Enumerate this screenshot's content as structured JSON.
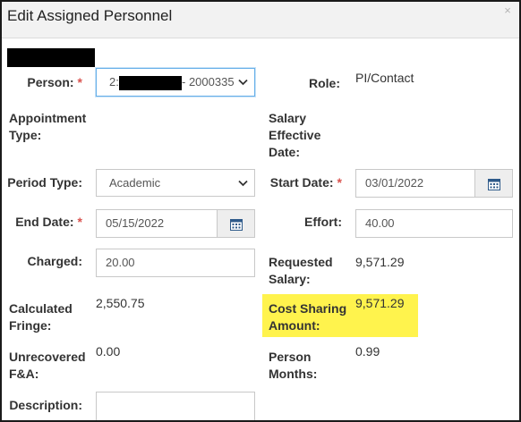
{
  "dialog": {
    "title": "Edit Assigned Personnel",
    "close_glyph": "×"
  },
  "form": {
    "person_label": "Person:",
    "person_value_prefix": "2:",
    "person_value_suffix": "- 2000335",
    "role_label": "Role:",
    "role_value": "PI/Contact",
    "appointment_type_label_line1": "Appointment",
    "appointment_type_label_line2": "Type:",
    "salary_effective_label_line1": "Salary",
    "salary_effective_label_line2": "Effective",
    "salary_effective_label_line3": "Date:",
    "period_type_label": "Period Type:",
    "period_type_value": "Academic",
    "start_date_label": "Start Date:",
    "start_date_value": "03/01/2022",
    "end_date_label": "End Date:",
    "end_date_value": "05/15/2022",
    "effort_label": "Effort:",
    "effort_value": "40.00",
    "charged_label": "Charged:",
    "charged_value": "20.00",
    "requested_salary_label_line1": "Requested",
    "requested_salary_label_line2": "Salary:",
    "requested_salary_value": "9,571.29",
    "calculated_fringe_label_line1": "Calculated",
    "calculated_fringe_label_line2": "Fringe:",
    "calculated_fringe_value": "2,550.75",
    "cost_sharing_label_line1": "Cost Sharing",
    "cost_sharing_label_line2": "Amount:",
    "cost_sharing_value": "9,571.29",
    "unrecovered_fa_label_line1": "Unrecovered",
    "unrecovered_fa_label_line2": "F&A:",
    "unrecovered_fa_value": "0.00",
    "person_months_label_line1": "Person",
    "person_months_label_line2": "Months:",
    "person_months_value": "0.99",
    "description_label": "Description:",
    "description_value": "",
    "required_marker": "*"
  },
  "colors": {
    "required": "#d9534f",
    "highlight": "#fff34d",
    "focus": "#66afe9"
  },
  "icons": {
    "calendar": "calendar-icon",
    "chevron": "chevron-down-icon",
    "close": "close-icon"
  }
}
